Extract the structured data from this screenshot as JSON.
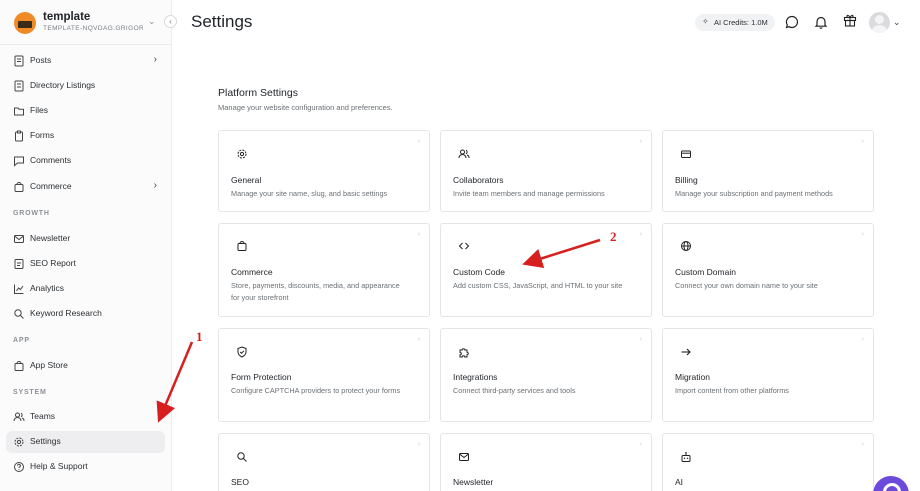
{
  "workspace": {
    "name": "template",
    "subtitle": "TEMPLATE-NQVDAG.GRIGOR..."
  },
  "sidebar": {
    "items": [
      {
        "label": "Posts",
        "icon": "posts-icon"
      },
      {
        "label": "Directory Listings",
        "icon": "directory-icon"
      },
      {
        "label": "Files",
        "icon": "folder-icon"
      },
      {
        "label": "Forms",
        "icon": "clipboard-icon"
      },
      {
        "label": "Comments",
        "icon": "comment-icon"
      },
      {
        "label": "Commerce",
        "icon": "bag-icon"
      },
      {
        "label": "Newsletter",
        "icon": "mail-icon"
      },
      {
        "label": "SEO Report",
        "icon": "report-icon"
      },
      {
        "label": "Analytics",
        "icon": "chart-icon"
      },
      {
        "label": "Keyword Research",
        "icon": "search-icon"
      },
      {
        "label": "App Store",
        "icon": "apps-icon"
      },
      {
        "label": "Teams",
        "icon": "users-icon"
      },
      {
        "label": "Settings",
        "icon": "gear-icon"
      },
      {
        "label": "Help & Support",
        "icon": "help-icon"
      }
    ],
    "sections": {
      "growth": "GROWTH",
      "app": "APP",
      "system": "SYSTEM"
    }
  },
  "header": {
    "title": "Settings",
    "credits": "AI Credits: 1.0M"
  },
  "platform": {
    "title": "Platform Settings",
    "subtitle": "Manage your website configuration and preferences."
  },
  "cards": [
    {
      "title": "General",
      "desc": "Manage your site name, slug, and basic settings",
      "icon": "gear-icon"
    },
    {
      "title": "Collaborators",
      "desc": "Invite team members and manage permissions",
      "icon": "users-icon"
    },
    {
      "title": "Billing",
      "desc": "Manage your subscription and payment methods",
      "icon": "card-icon"
    },
    {
      "title": "Commerce",
      "desc": "Store, payments, discounts, media, and appearance for your storefront",
      "icon": "bag-icon"
    },
    {
      "title": "Custom Code",
      "desc": "Add custom CSS, JavaScript, and HTML to your site",
      "icon": "code-icon"
    },
    {
      "title": "Custom Domain",
      "desc": "Connect your own domain name to your site",
      "icon": "globe-icon"
    },
    {
      "title": "Form Protection",
      "desc": "Configure CAPTCHA providers to protect your forms",
      "icon": "shield-icon"
    },
    {
      "title": "Integrations",
      "desc": "Connect third-party services and tools",
      "icon": "puzzle-icon"
    },
    {
      "title": "Migration",
      "desc": "Import content from other platforms",
      "icon": "arrow-right-icon"
    },
    {
      "title": "SEO",
      "desc": "",
      "icon": "search-icon"
    },
    {
      "title": "Newsletter",
      "desc": "",
      "icon": "mail-icon"
    },
    {
      "title": "AI",
      "desc": "",
      "icon": "robot-icon"
    }
  ],
  "annotations": [
    "1",
    "2"
  ],
  "colors": {
    "annotation": "#d71f1f",
    "fab": "#6c4bdc"
  }
}
